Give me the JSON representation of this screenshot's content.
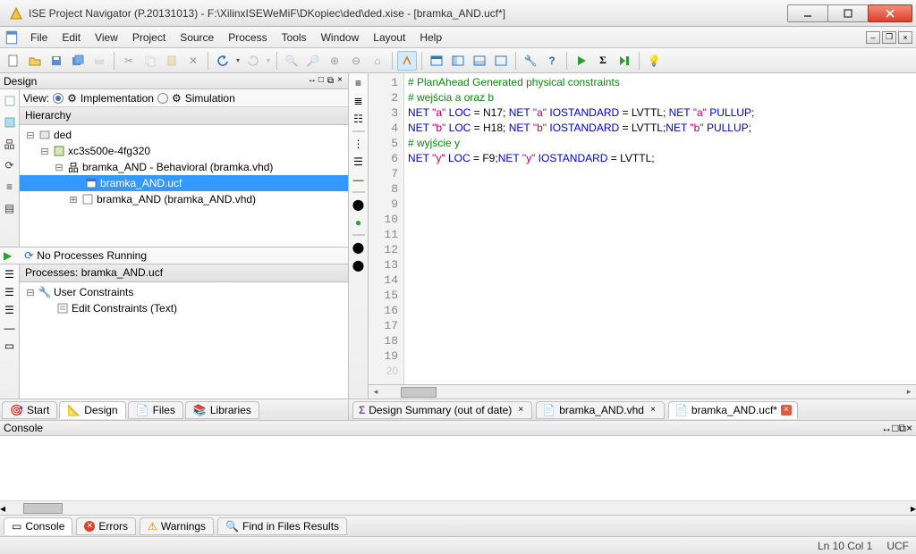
{
  "title": "ISE Project Navigator (P.20131013) - F:\\XilinxISEWeMiF\\DKopiec\\ded\\ded.xise - [bramka_AND.ucf*]",
  "menu": {
    "file": "File",
    "edit": "Edit",
    "view": "View",
    "project": "Project",
    "source": "Source",
    "process": "Process",
    "tools": "Tools",
    "window": "Window",
    "layout": "Layout",
    "help": "Help"
  },
  "design": {
    "panel_title": "Design",
    "view_label": "View:",
    "impl": "Implementation",
    "sim": "Simulation",
    "hierarchy": "Hierarchy",
    "nodes": {
      "project": "ded",
      "device": "xc3s500e-4fg320",
      "top": "bramka_AND - Behavioral (bramka.vhd)",
      "ucf": "bramka_AND.ucf",
      "instance": "bramka_AND (bramka_AND.vhd)"
    },
    "no_proc": "No Processes Running",
    "proc_for": "Processes: bramka_AND.ucf",
    "user_constraints": "User Constraints",
    "edit_constraints": "Edit Constraints (Text)"
  },
  "left_tabs": {
    "start": "Start",
    "design": "Design",
    "files": "Files",
    "libraries": "Libraries"
  },
  "chart_data": {
    "type": "table",
    "title": "bramka_AND.ucf",
    "columns": [
      "net",
      "LOC",
      "IOSTANDARD",
      "PULLUP"
    ],
    "rows": [
      {
        "net": "a",
        "LOC": "N17",
        "IOSTANDARD": "LVTTL",
        "PULLUP": true,
        "comment": "wejścia a oraz b"
      },
      {
        "net": "b",
        "LOC": "H18",
        "IOSTANDARD": "LVTTL",
        "PULLUP": true,
        "comment": "wejścia a oraz b"
      },
      {
        "net": "y",
        "LOC": "F9",
        "IOSTANDARD": "LVTTL",
        "PULLUP": false,
        "comment": "wyjście y"
      }
    ]
  },
  "code": {
    "l1": "# PlanAhead Generated physical constraints",
    "l2": "# wejścia a oraz b",
    "l3": {
      "net1": "NET ",
      "a": "\"a\"",
      "loc": " LOC ",
      "eq": "= N17; ",
      "net2": "NET ",
      "io": " IOSTANDARD ",
      "eqio": "= LVTTL; ",
      "net3": "NET ",
      "pull": " PULLUP",
      "semi": ";"
    },
    "l4": {
      "net1": "NET ",
      "b": "\"b\"",
      "loc": " LOC ",
      "eq": "= H18; ",
      "net2": "NET ",
      "io": " IOSTANDARD ",
      "eqio": "= LVTTL;",
      "net3": "NET ",
      "pull": " PULLUP",
      "semi": ";"
    },
    "l5": "# wyjście y",
    "l6": {
      "net1": "NET ",
      "y": "\"y\"",
      "loc": " LOC ",
      "eq": "= F9;",
      "net2": "NET ",
      "io": " IOSTANDARD ",
      "eqio": "= LVTTL;"
    }
  },
  "editor_tabs": {
    "summary": "Design Summary (out of date)",
    "vhd": "bramka_AND.vhd",
    "ucf": "bramka_AND.ucf*"
  },
  "console": {
    "title": "Console"
  },
  "bottom_tabs": {
    "console": "Console",
    "errors": "Errors",
    "warnings": "Warnings",
    "find": "Find in Files Results"
  },
  "status": {
    "pos": "Ln 10 Col 1",
    "mode": "UCF"
  }
}
